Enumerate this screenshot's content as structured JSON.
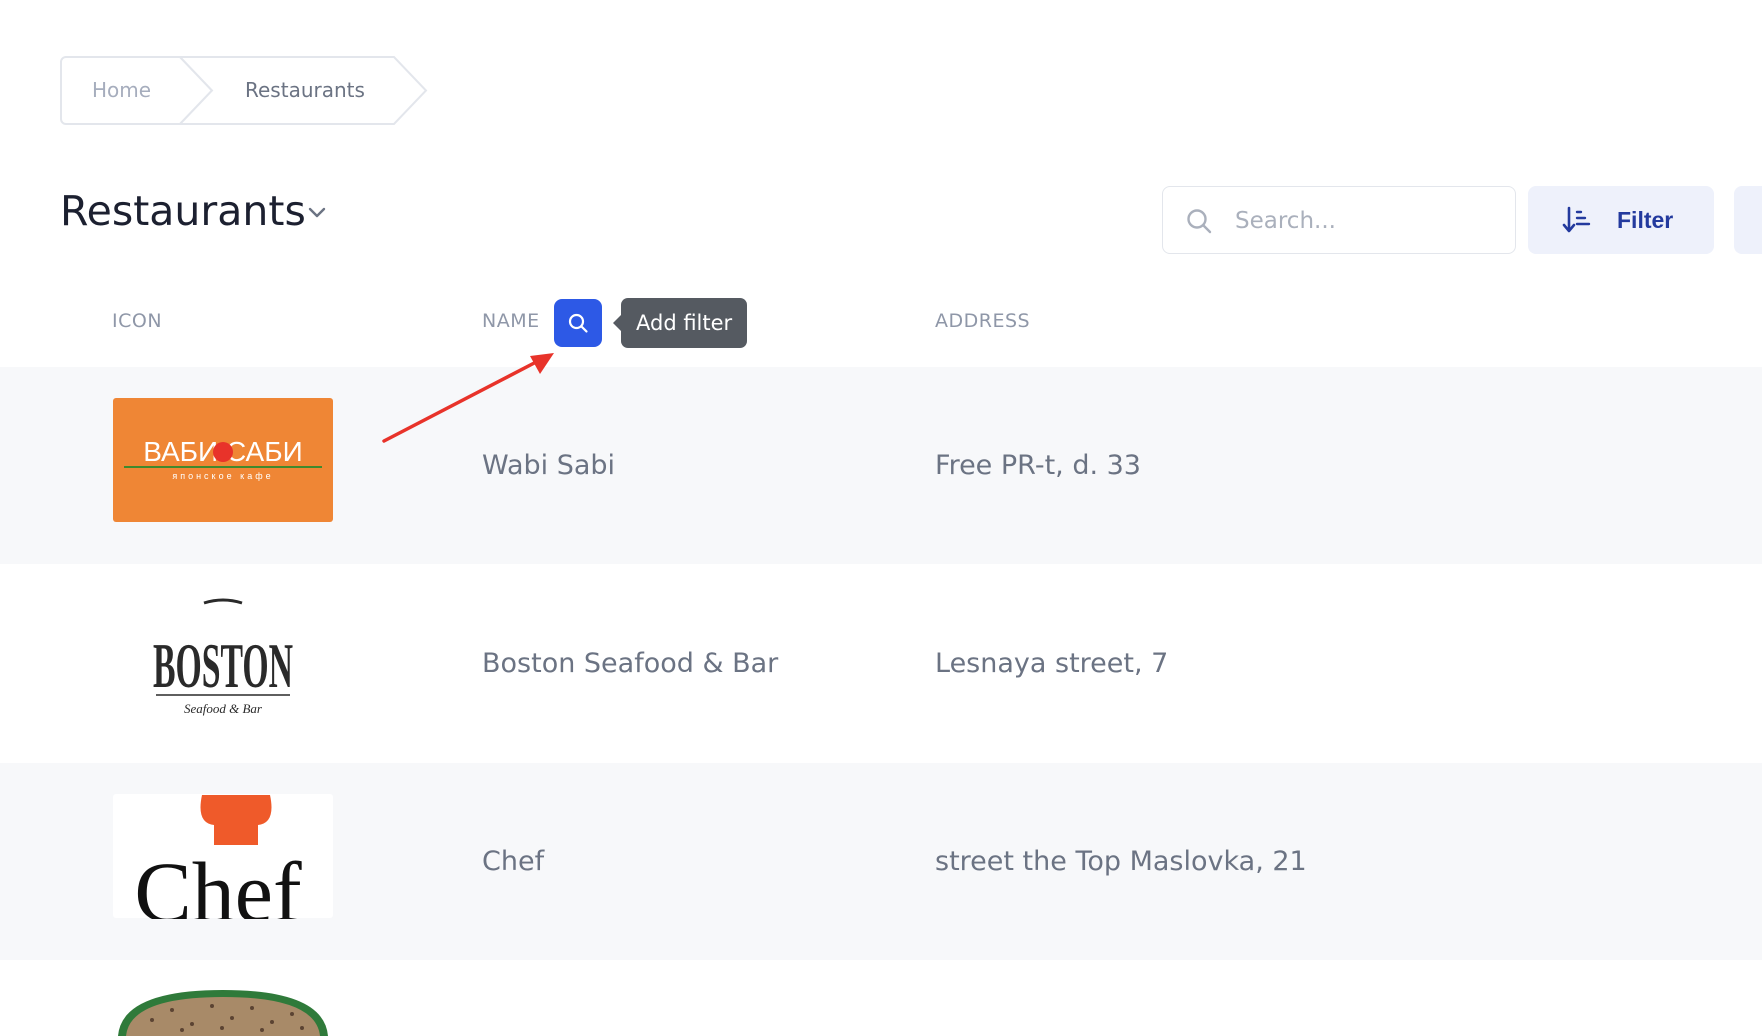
{
  "breadcrumb": {
    "home": "Home",
    "current": "Restaurants"
  },
  "header": {
    "title": "Restaurants",
    "search_placeholder": "Search...",
    "filter_label": "Filter"
  },
  "table": {
    "columns": {
      "icon": "ICON",
      "name": "NAME",
      "address": "ADDRESS"
    },
    "name_tooltip": "Add filter",
    "rows": [
      {
        "name": "Wabi Sabi",
        "address": "Free PR-t, d. 33",
        "logo": "wabi-sabi-logo",
        "logo_text": "ВАБИ САБИ",
        "logo_subtext": "японское кафе"
      },
      {
        "name": "Boston Seafood & Bar",
        "address": "Lesnaya street, 7",
        "logo": "boston-logo",
        "logo_text": "BOSTON",
        "logo_subtext": "Seafood & Bar"
      },
      {
        "name": "Chef",
        "address": "street the Top Maslovka, 21",
        "logo": "chef-logo",
        "logo_text": "Chef"
      },
      {
        "name": "",
        "address": "",
        "logo": "round-food-logo"
      }
    ]
  },
  "colors": {
    "accent": "#2d59e6",
    "filter_text": "#233a9e",
    "row_alt_bg": "#f7f8fa",
    "tooltip_bg": "#555a61",
    "annotation_red": "#e8332a"
  }
}
